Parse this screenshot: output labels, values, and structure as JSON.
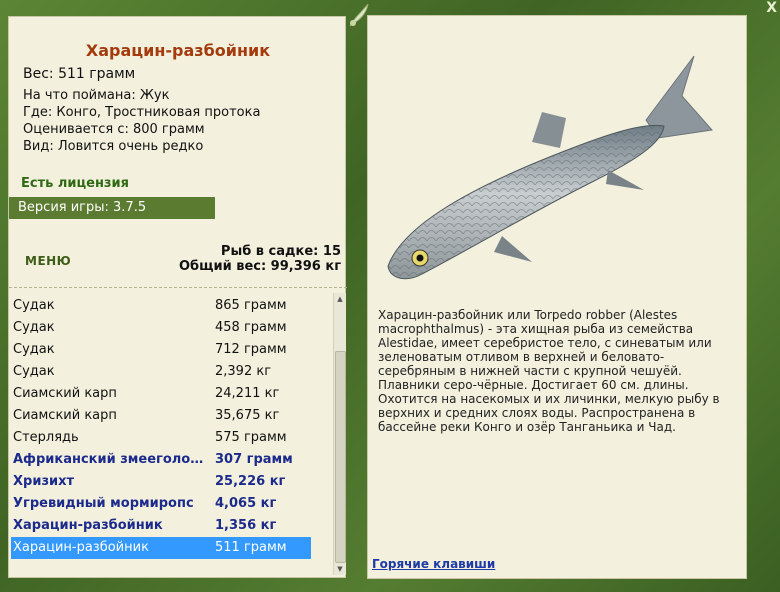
{
  "fish": {
    "title": "Харацин-разбойник",
    "weight_line": "Вес: 511 грамм",
    "bait": "На что поймана: Жук",
    "location": "Где: Конго, Тростниковая протока",
    "valued": "Оценивается с: 800 грамм",
    "kind": "Вид: Ловится очень редко"
  },
  "license": "Есть лицензия",
  "version": "Версия игры: 3.7.5",
  "menu_label": "МЕНЮ",
  "stats": {
    "count": "Рыб в садке: 15",
    "total": "Общий вес: 99,396 кг"
  },
  "catch_list": [
    {
      "name": "Судак",
      "weight": "865 грамм",
      "style": "normal"
    },
    {
      "name": "Судак",
      "weight": "458 грамм",
      "style": "normal"
    },
    {
      "name": "Судак",
      "weight": "712 грамм",
      "style": "normal"
    },
    {
      "name": "Судак",
      "weight": "2,392 кг",
      "style": "normal"
    },
    {
      "name": "Сиамский карп",
      "weight": "24,211 кг",
      "style": "normal"
    },
    {
      "name": "Сиамский карп",
      "weight": "35,675 кг",
      "style": "normal"
    },
    {
      "name": "Стерлядь",
      "weight": "575 грамм",
      "style": "normal"
    },
    {
      "name": "Африканский змееголо…",
      "weight": "307 грамм",
      "style": "bold"
    },
    {
      "name": "Хризихт",
      "weight": "25,226 кг",
      "style": "bold"
    },
    {
      "name": "Угревидный мормиропс",
      "weight": "4,065 кг",
      "style": "bold"
    },
    {
      "name": "Харацин-разбойник",
      "weight": "1,356 кг",
      "style": "bold"
    },
    {
      "name": "Харацин-разбойник",
      "weight": "511 грамм",
      "style": "selected"
    }
  ],
  "description": "Харацин-разбойник или Torpedo robber (Alestes macrophthalmus) - эта хищная рыба из семейства Alestidae, имеет серебристое тело, с синеватым или зеленоватым отливом в верхней и беловато-серебряным в нижней части с крупной чешуёй. Плавники серо-чёрные. Достигает 60 см. длины. Охотится на насекомых и их личинки, мелкую рыбу в верхних и средних слоях воды. Распространена в бассейне реки Конго и озёр Танганьика и Чад.",
  "hotkeys_label": "Горячие клавиши",
  "close_label": "X",
  "colors": {
    "frame": "#4a6f2c",
    "panel": "#f3f1de",
    "title": "#a33b0c",
    "license": "#2f6a12",
    "selection": "#3399ff",
    "rare_text": "#1c2a8c",
    "link": "#1c3aa8"
  }
}
